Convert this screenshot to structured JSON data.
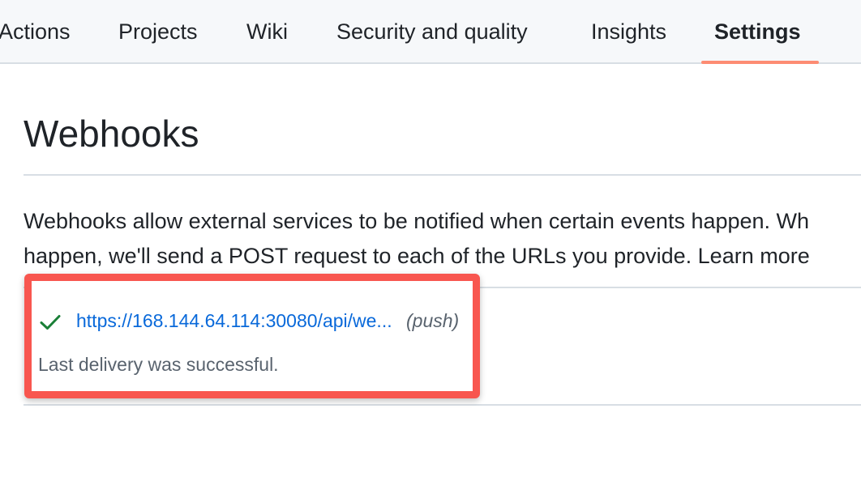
{
  "nav": {
    "tabs": [
      {
        "label": "Actions"
      },
      {
        "label": "Projects"
      },
      {
        "label": "Wiki"
      },
      {
        "label": "Security and quality"
      },
      {
        "label": "Insights"
      },
      {
        "label": "Settings",
        "selected": true
      }
    ],
    "underline_color": "#fd8c73"
  },
  "page": {
    "title": "Webhooks",
    "description_line1": "Webhooks allow external services to be notified when certain events happen. Wh",
    "description_line2_prefix": "happen, we'll send a POST request to each of the URLs you provide. ",
    "learn_more": "Learn more"
  },
  "webhooks": [
    {
      "status_icon": "check-icon",
      "url": "https://168.144.64.114:30080/api/we...",
      "events": "(push)",
      "last_delivery": "Last delivery was successful."
    }
  ],
  "colors": {
    "link": "#0969da",
    "success": "#1a7f37",
    "highlight": "#f8564f",
    "muted": "#59636e"
  }
}
